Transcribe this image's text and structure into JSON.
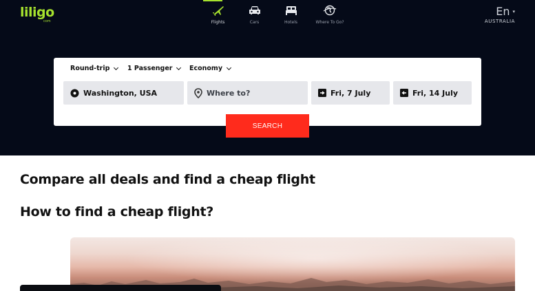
{
  "brand": {
    "logo": "liligo",
    "sub": "com"
  },
  "nav": [
    {
      "label": "Flights",
      "icon": "plane-icon",
      "active": true
    },
    {
      "label": "Cars",
      "icon": "car-icon",
      "active": false
    },
    {
      "label": "Hotels",
      "icon": "bed-icon",
      "active": false
    },
    {
      "label": "Where To Go?",
      "icon": "globe-icon",
      "active": false
    }
  ],
  "locale": {
    "language": "En",
    "country": "AUSTRALIA"
  },
  "search": {
    "trip_type": "Round-trip",
    "passengers": "1 Passenger",
    "cabin": "Economy",
    "from_value": "Washington, USA",
    "to_placeholder": "Where to?",
    "depart_date": "Fri, 7 July",
    "return_date": "Fri, 14 July",
    "button_label": "SEARCH"
  },
  "content": {
    "heading_compare": "Compare all deals and find a cheap flight",
    "heading_how": "How to find a cheap flight?"
  },
  "colors": {
    "hero_bg": "#050a18",
    "accent": "#a6e22e",
    "search_button": "#ff2b1c",
    "field_bg": "#e6e7eb"
  }
}
